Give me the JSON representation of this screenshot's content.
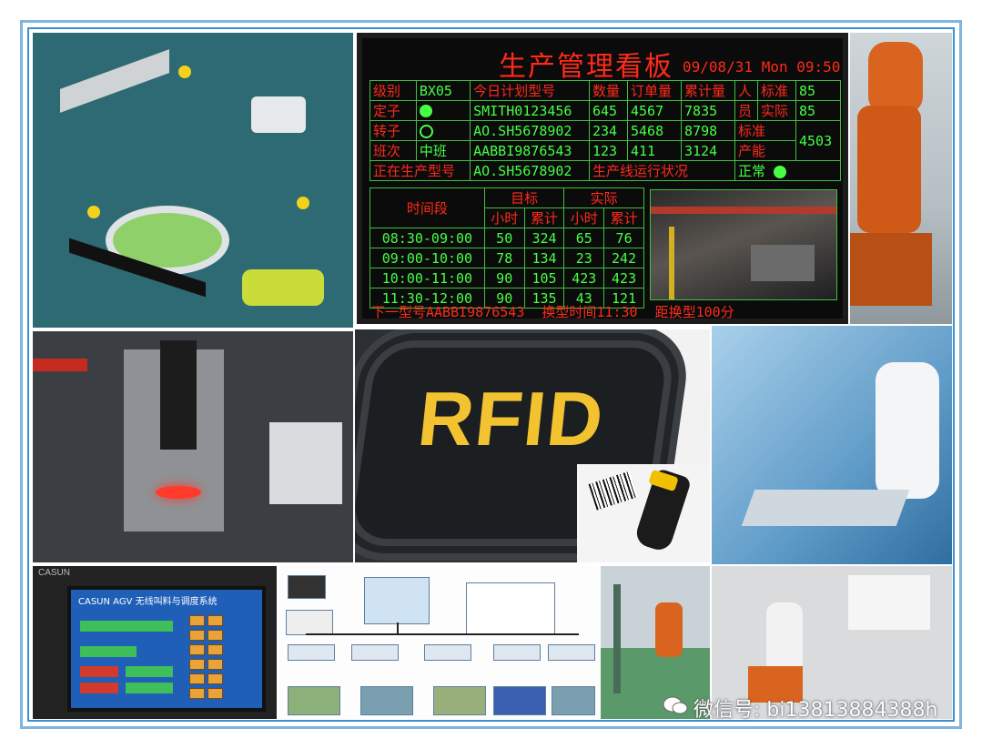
{
  "led_board": {
    "title": "生产管理看板",
    "datetime": "09/08/31 Mon 09:50",
    "rows": [
      [
        "级别",
        "BX05",
        "今日计划型号",
        "数量",
        "订单量",
        "累计量",
        "人",
        "标准",
        "85"
      ],
      [
        "定子",
        "",
        "SMITH0123456",
        "645",
        "4567",
        "7835",
        "员",
        "实际",
        "85"
      ],
      [
        "转子",
        "",
        "AO.SH5678902",
        "234",
        "5468",
        "8798",
        "标准",
        "",
        ""
      ],
      [
        "班次",
        "中班",
        "AABBI9876543",
        "123",
        "411",
        "3124",
        "产能",
        "4503",
        ""
      ]
    ],
    "producing_label": "正在生产型号",
    "producing_model": "AO.SH5678902",
    "line_status_label": "生产线运行状况",
    "line_status_value": "正常",
    "period_header": "时间段",
    "target_header": "目标",
    "actual_header": "实际",
    "hour_label": "小时",
    "total_label": "累计",
    "periods": [
      {
        "time": "08:30-09:00",
        "t_hour": "50",
        "t_total": "324",
        "a_hour": "65",
        "a_total": "76"
      },
      {
        "time": "09:00-10:00",
        "t_hour": "78",
        "t_total": "134",
        "a_hour": "23",
        "a_total": "242"
      },
      {
        "time": "10:00-11:00",
        "t_hour": "90",
        "t_total": "105",
        "a_hour": "423",
        "a_total": "423"
      },
      {
        "time": "11:30-12:00",
        "t_hour": "90",
        "t_total": "135",
        "a_hour": "43",
        "a_total": "121"
      }
    ],
    "next_model": "下一型号AABBI9876543",
    "changeover_time": "换型时间11:30",
    "time_to_change": "距换型100分"
  },
  "rfid": {
    "text": "RFID"
  },
  "hmi": {
    "brand": "CASUN",
    "header": "CASUN  AGV 无线叫料与调度系统"
  },
  "watermark": {
    "text": "微信号: bi13813884388h"
  },
  "colors": {
    "frame_outer": "#7fb6dc",
    "frame_inner": "#3f8fd0",
    "led_red": "#ff2a1a",
    "led_green": "#44ff44",
    "rfid_gold": "#f2c230"
  }
}
